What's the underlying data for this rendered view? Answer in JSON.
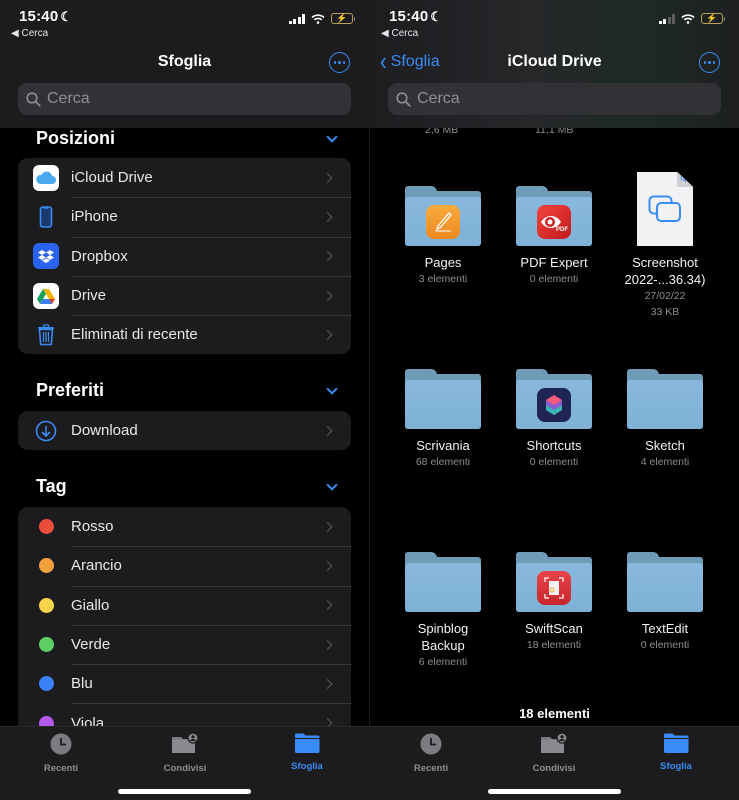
{
  "status_bar": {
    "time": "15:40",
    "back_app": "◀ Cerca"
  },
  "left": {
    "nav_title": "Sfoglia",
    "search_placeholder": "Cerca",
    "sections": {
      "positions": {
        "title": "Posizioni",
        "items": [
          {
            "label": "iCloud Drive",
            "icon": "icloud-icon"
          },
          {
            "label": "iPhone",
            "icon": "iphone-icon"
          },
          {
            "label": "Dropbox",
            "icon": "dropbox-icon"
          },
          {
            "label": "Drive",
            "icon": "google-drive-icon"
          },
          {
            "label": "Eliminati di recente",
            "icon": "trash-icon"
          }
        ]
      },
      "favorites": {
        "title": "Preferiti",
        "items": [
          {
            "label": "Download",
            "icon": "download-icon"
          }
        ]
      },
      "tags": {
        "title": "Tag",
        "items": [
          {
            "label": "Rosso",
            "color": "#eb4d3d"
          },
          {
            "label": "Arancio",
            "color": "#f2a03d"
          },
          {
            "label": "Giallo",
            "color": "#f7d34a"
          },
          {
            "label": "Verde",
            "color": "#5fcf65"
          },
          {
            "label": "Blu",
            "color": "#3b82f6"
          },
          {
            "label": "Viola",
            "color": "#b25bea"
          }
        ]
      }
    }
  },
  "right": {
    "back_label": "Sfoglia",
    "nav_title": "iCloud Drive",
    "search_placeholder": "Cerca",
    "cut_sizes": [
      "2,6 MB",
      "11,1 MB"
    ],
    "items": [
      {
        "name": "Pages",
        "sub": "3 elementi",
        "type": "folder",
        "app": "pages"
      },
      {
        "name": "PDF Expert",
        "sub": "0 elementi",
        "type": "folder",
        "app": "pdfexpert"
      },
      {
        "name": "Screenshot 2022-...36.34)",
        "sub": "27/02/22",
        "sub2": "33 KB",
        "type": "file"
      },
      {
        "name": "Scrivania",
        "sub": "68 elementi",
        "type": "folder"
      },
      {
        "name": "Shortcuts",
        "sub": "0 elementi",
        "type": "folder",
        "app": "shortcuts"
      },
      {
        "name": "Sketch",
        "sub": "4 elementi",
        "type": "folder"
      },
      {
        "name": "Spinblog Backup",
        "sub": "6 elementi",
        "type": "folder"
      },
      {
        "name": "SwiftScan",
        "sub": "18 elementi",
        "type": "folder",
        "app": "swiftscan"
      },
      {
        "name": "TextEdit",
        "sub": "0 elementi",
        "type": "folder"
      }
    ],
    "footer_count": "18 elementi"
  },
  "tabbar": {
    "tabs": [
      {
        "label": "Recenti",
        "icon": "clock-icon"
      },
      {
        "label": "Condivisi",
        "icon": "shared-folder-icon"
      },
      {
        "label": "Sfoglia",
        "icon": "folder-icon",
        "active": true
      }
    ]
  },
  "colors": {
    "accent": "#3a8bf5",
    "background": "#000000",
    "group_bg": "#1c1c1e"
  }
}
